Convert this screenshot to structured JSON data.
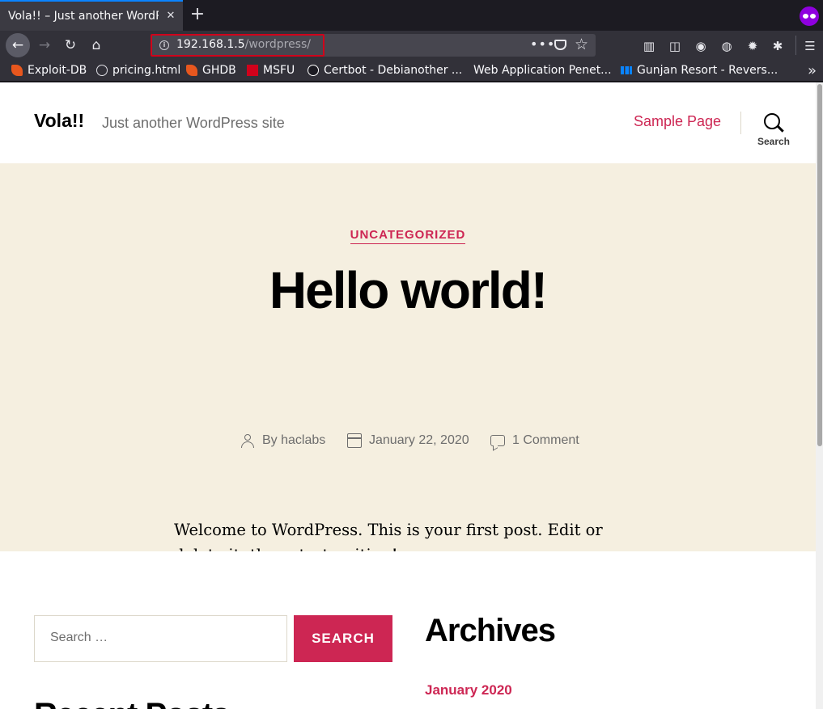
{
  "browser": {
    "tab_title": "Vola!! – Just another WordPress site",
    "tab_close": "✕",
    "new_tab": "+",
    "url_host": "192.168.1.5",
    "url_path": "/wordpress/",
    "url_dots": "•••"
  },
  "bookmarks": [
    {
      "label": "Exploit-DB",
      "icon": "exploit-db-icon",
      "color": "#e8571e"
    },
    {
      "label": "pricing.html",
      "icon": "globe-icon",
      "color": "#e0e0e6"
    },
    {
      "label": "GHDB",
      "icon": "ghdb-icon",
      "color": "#e8571e"
    },
    {
      "label": "MSFU",
      "icon": "msfu-icon",
      "color": "#d0021b"
    },
    {
      "label": "Certbot - Debianother ...",
      "icon": "certbot-icon",
      "color": "#ffffff"
    },
    {
      "label": "Web Application Penet...",
      "icon": "web-icon",
      "color": "#888888"
    },
    {
      "label": "Gunjan Resort - Revers...",
      "icon": "chart-icon",
      "color": "#0a84ff"
    }
  ],
  "site": {
    "title": "Vola!!",
    "description": "Just another WordPress site",
    "menu_item": "Sample Page",
    "search_label": "Search"
  },
  "post": {
    "category": "UNCATEGORIZED",
    "title": "Hello world!",
    "author": "By haclabs",
    "date": "January 22, 2020",
    "comments": "1 Comment",
    "body": "Welcome to WordPress. This is your first post. Edit or delete it, then start writing!"
  },
  "widgets": {
    "search_placeholder": "Search …",
    "search_button": "SEARCH",
    "archives_title": "Archives",
    "archive_link": "January 2020",
    "recent_posts_title": "Recent Posts"
  },
  "colors": {
    "accent": "#cd2653",
    "hero_bg": "#f5efe0",
    "chrome_bg": "#323139"
  }
}
